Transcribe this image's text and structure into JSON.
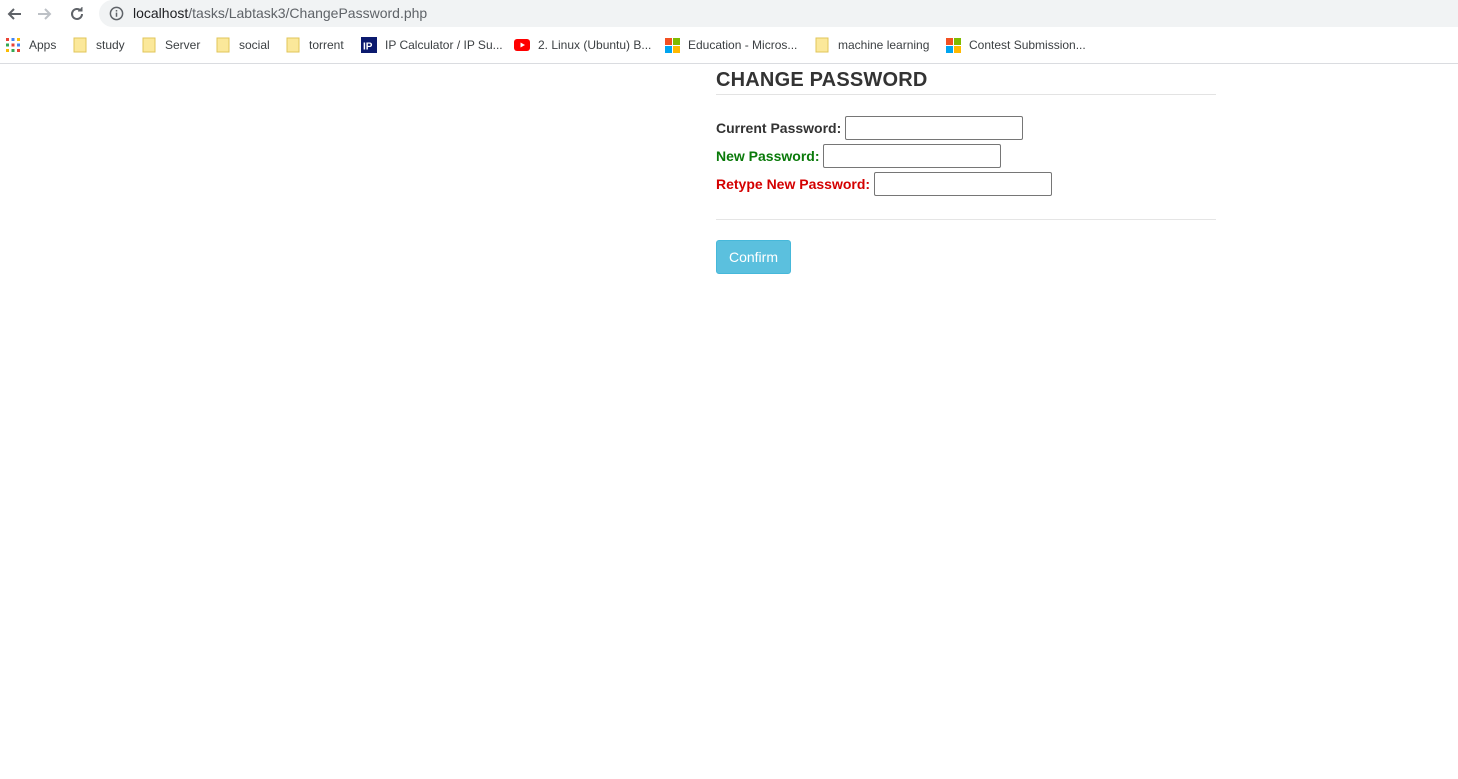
{
  "browser": {
    "url_host": "localhost",
    "url_path": "/tasks/Labtask3/ChangePassword.php",
    "bookmarks": [
      {
        "label": "Apps",
        "icon": "apps-grid-icon"
      },
      {
        "label": "study",
        "icon": "folder-icon"
      },
      {
        "label": "Server",
        "icon": "folder-icon"
      },
      {
        "label": "social",
        "icon": "folder-icon"
      },
      {
        "label": "torrent",
        "icon": "folder-icon"
      },
      {
        "label": "IP Calculator / IP Su...",
        "icon": "ip-site-icon"
      },
      {
        "label": "2. Linux (Ubuntu) B...",
        "icon": "youtube-icon"
      },
      {
        "label": "Education - Micros...",
        "icon": "microsoft-icon"
      },
      {
        "label": "machine learning",
        "icon": "folder-icon"
      },
      {
        "label": "Contest Submission...",
        "icon": "microsoft-icon"
      }
    ]
  },
  "form": {
    "title": "CHANGE PASSWORD",
    "current_label": "Current Password:",
    "current_value": "",
    "new_label": "New Password:",
    "new_value": "",
    "retype_label": "Retype New Password:",
    "retype_value": "",
    "confirm_label": "Confirm"
  },
  "colors": {
    "current_label": "#333333",
    "new_label": "#0a7a0a",
    "retype_label": "#d40000",
    "confirm_button": "#5bc0de"
  }
}
